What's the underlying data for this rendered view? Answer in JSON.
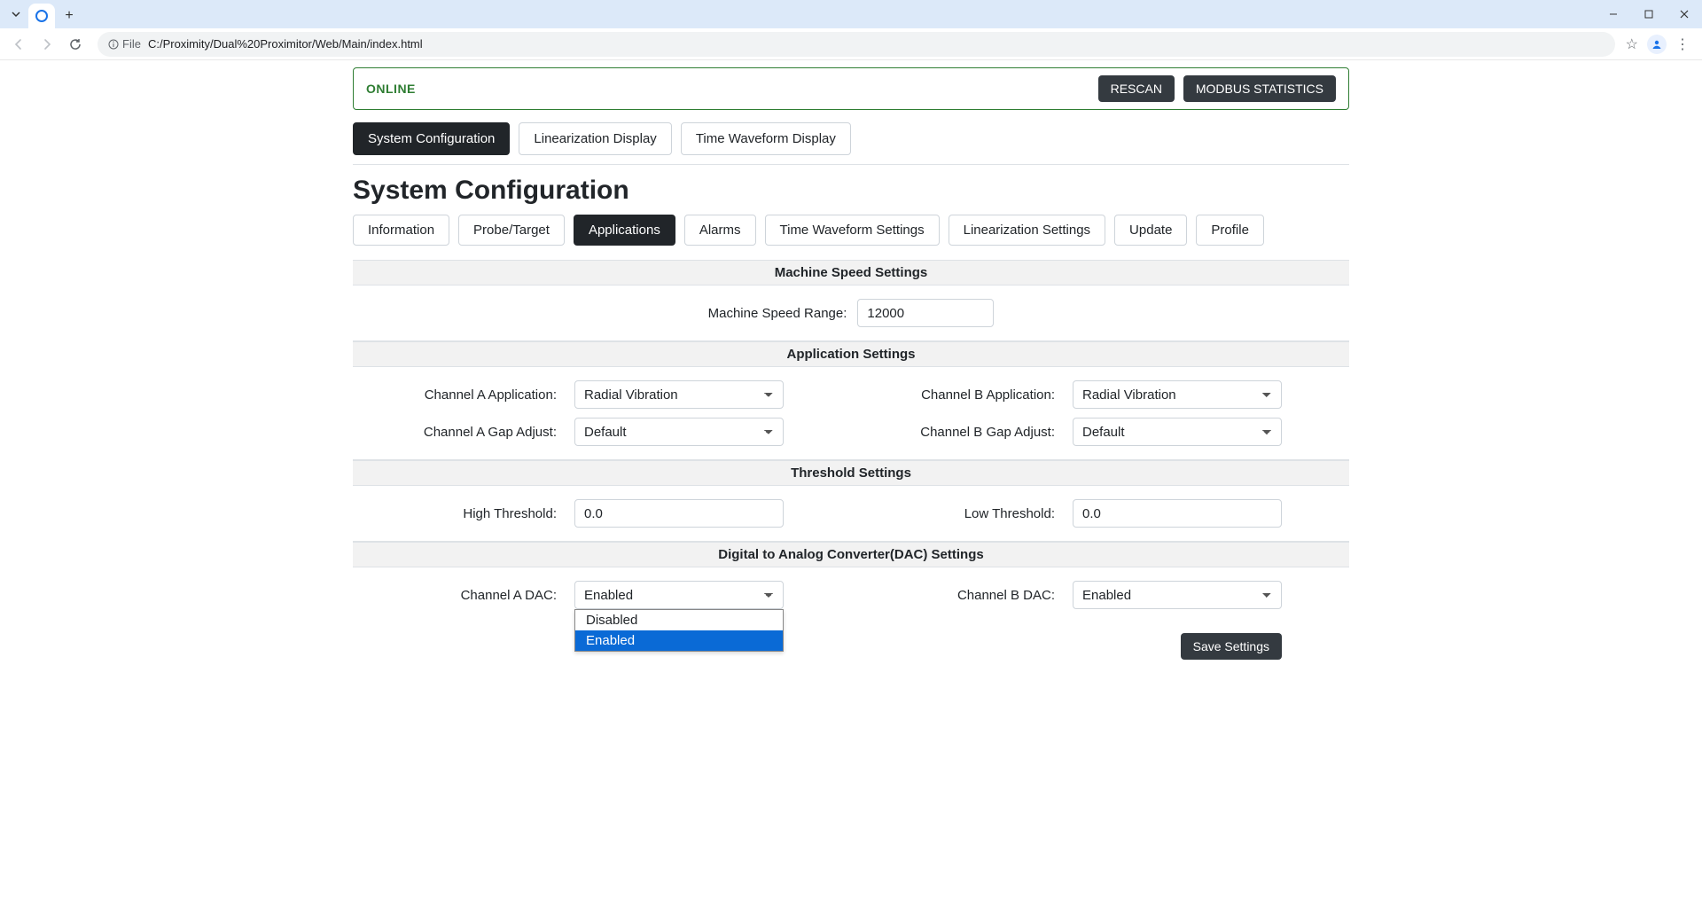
{
  "browser": {
    "url_label": "File",
    "url": "C:/Proximity/Dual%20Proximitor/Web/Main/index.html"
  },
  "status": {
    "text": "ONLINE",
    "buttons": {
      "rescan": "RESCAN",
      "modbus": "MODBUS STATISTICS"
    }
  },
  "main_tabs": [
    {
      "label": "System Configuration",
      "active": true
    },
    {
      "label": "Linearization Display",
      "active": false
    },
    {
      "label": "Time Waveform Display",
      "active": false
    }
  ],
  "page_title": "System Configuration",
  "sub_tabs": [
    {
      "label": "Information"
    },
    {
      "label": "Probe/Target"
    },
    {
      "label": "Applications",
      "active": true
    },
    {
      "label": "Alarms"
    },
    {
      "label": "Time Waveform Settings"
    },
    {
      "label": "Linearization Settings"
    },
    {
      "label": "Update"
    },
    {
      "label": "Profile"
    }
  ],
  "sections": {
    "machine_speed": {
      "title": "Machine Speed Settings",
      "range_label": "Machine Speed Range:",
      "range_value": "12000"
    },
    "application": {
      "title": "Application Settings",
      "ch_a_app_label": "Channel A Application:",
      "ch_a_app_value": "Radial Vibration",
      "ch_b_app_label": "Channel B Application:",
      "ch_b_app_value": "Radial Vibration",
      "ch_a_gap_label": "Channel A Gap Adjust:",
      "ch_a_gap_value": "Default",
      "ch_b_gap_label": "Channel B Gap Adjust:",
      "ch_b_gap_value": "Default"
    },
    "threshold": {
      "title": "Threshold Settings",
      "high_label": "High Threshold:",
      "high_value": "0.0",
      "low_label": "Low Threshold:",
      "low_value": "0.0"
    },
    "dac": {
      "title": "Digital to Analog Converter(DAC) Settings",
      "ch_a_label": "Channel A DAC:",
      "ch_a_value": "Enabled",
      "ch_a_options": [
        "Disabled",
        "Enabled"
      ],
      "ch_a_highlight": "Enabled",
      "ch_b_label": "Channel B DAC:",
      "ch_b_value": "Enabled"
    }
  },
  "save_label": "Save Settings"
}
